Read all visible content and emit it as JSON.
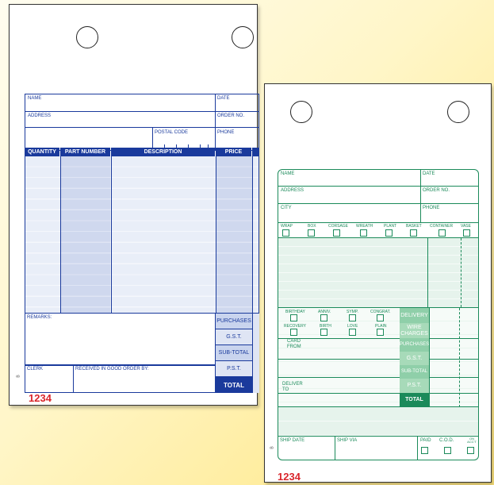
{
  "form_a": {
    "header": {
      "name": "NAME",
      "date": "DATE",
      "address": "ADDRESS",
      "order_no": "ORDER NO.",
      "postal_code": "POSTAL CODE",
      "phone": "PHONE"
    },
    "columns": [
      "QUANTITY",
      "PART NUMBER",
      "DESCRIPTION",
      "PRICE"
    ],
    "remarks": "REMARKS:",
    "totals": [
      "PURCHASES",
      "G.S.T.",
      "SUB-TOTAL",
      "P.S.T."
    ],
    "total": "TOTAL",
    "clerk": "CLERK",
    "received": "RECEIVED IN GOOD ORDER BY:",
    "side_code": "B",
    "number": "1234"
  },
  "form_b": {
    "header": {
      "name": "NAME",
      "date": "DATE",
      "address": "ADDRESS",
      "order_no": "ORDER NO.",
      "city": "CITY",
      "phone": "PHONE"
    },
    "items": [
      "WRAP",
      "BOX",
      "CORSAGE",
      "WREATH",
      "PLANT",
      "BASKET",
      "CONTAINER",
      "VASE"
    ],
    "occasions_row1": [
      "BIRTHDAY",
      "ANNIV.",
      "SYMP.",
      "CONGRAT."
    ],
    "occasions_row2": [
      "RECOVERY",
      "BIRTH",
      "LOVE",
      "PLAIN"
    ],
    "card_from": "CARD FROM",
    "deliver_to": "DELIVER TO",
    "totals": [
      "DELIVERY",
      "WIRE CHARGES",
      "PURCHASES",
      "G.S.T.",
      "SUB-TOTAL",
      "P.S.T."
    ],
    "total": "TOTAL",
    "ship_date": "SHIP DATE",
    "ship_via": "SHIP VIA",
    "paid": "PAID",
    "cod": "C.O.D.",
    "on_acct": "ON ACC'T",
    "side_code": "B",
    "number": "1234"
  }
}
